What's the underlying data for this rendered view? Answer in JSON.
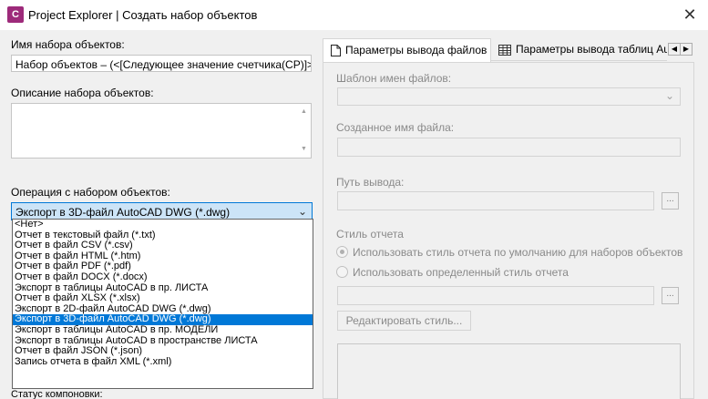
{
  "window": {
    "title": "Project Explorer | Создать набор объектов",
    "app_icon_text": "C",
    "close_glyph": "✕"
  },
  "left": {
    "name_label": "Имя набора объектов:",
    "name_value": "Набор объектов – (<[Следующее значение счетчика(CP)]>)",
    "description_label": "Описание набора объектов:",
    "operation_label": "Операция с набором объектов:",
    "operation_selected": "Экспорт в 3D-файл AutoCAD DWG (*.dwg)",
    "operation_options": [
      "<Нет>",
      "Отчет в текстовый файл (*.txt)",
      "Отчет в файл CSV (*.csv)",
      "Отчет в файл HTML (*.htm)",
      "Отчет в файл PDF (*.pdf)",
      "Отчет в файл DOCX (*.docx)",
      "Экспорт в таблицы AutoCAD в пр. ЛИСТА",
      "Отчет в файл XLSX (*.xlsx)",
      "Экспорт в 2D-файл AutoCAD DWG (*.dwg)",
      "Экспорт в 3D-файл AutoCAD DWG (*.dwg)",
      "Экспорт в таблицы AutoCAD в пр. МОДЕЛИ",
      "Экспорт в таблицы AutoCAD в пространстве ЛИСТА",
      "Отчет в файл JSON (*.json)",
      "Запись отчета в файл XML (*.xml)"
    ],
    "selected_index": 9,
    "bottom_partial_label": "Статус компоновки:"
  },
  "tabs": {
    "active_label": "Параметры вывода файлов",
    "inactive_label": "Параметры вывода таблиц AutoCAD",
    "scroll_left": "◀",
    "scroll_right": "▶"
  },
  "panel": {
    "template_label": "Шаблон имен файлов:",
    "created_name_label": "Созданное имя файла:",
    "output_path_label": "Путь вывода:",
    "browse_glyph": "...",
    "report_style_label": "Стиль отчета",
    "radio_default": "Использовать стиль отчета по умолчанию для наборов объектов",
    "radio_specific": "Использовать определенный стиль отчета",
    "edit_style_button": "Редактировать стиль..."
  },
  "colors": {
    "selection": "#0078d7",
    "combo_focus": "#cce4f7",
    "app_icon": "#9d2a7a"
  }
}
